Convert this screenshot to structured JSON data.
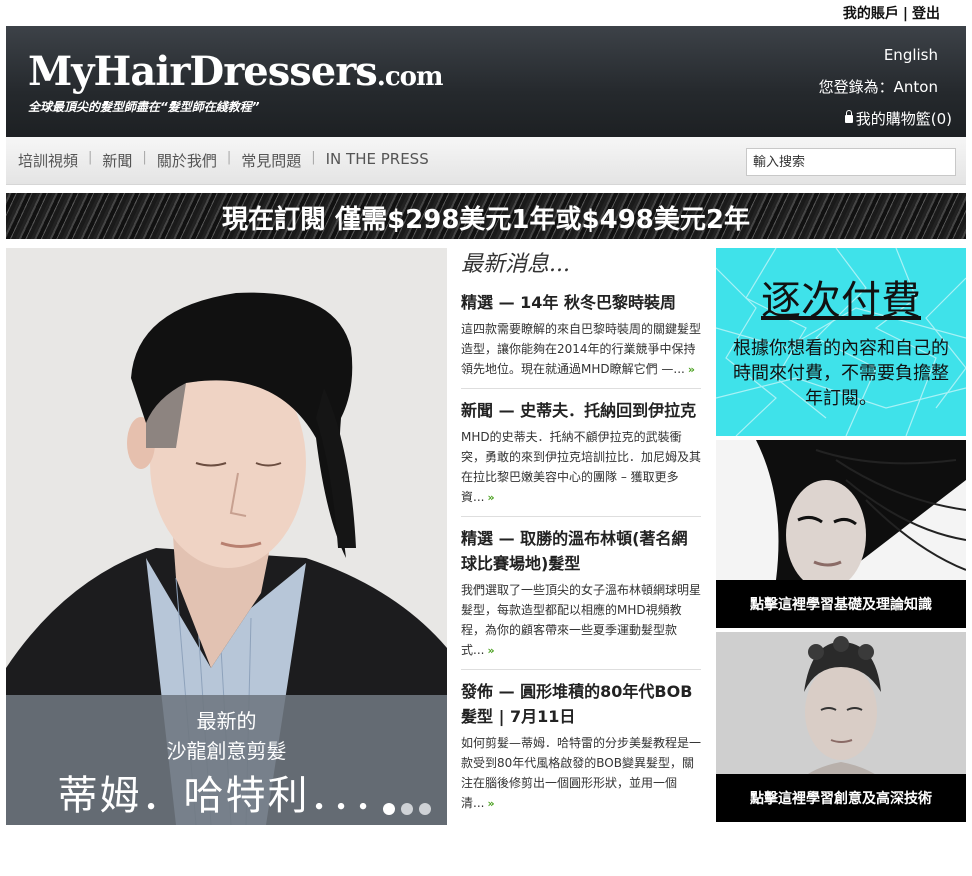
{
  "account": {
    "my_account": "我的賬戶",
    "separator": "|",
    "logout": "登出"
  },
  "header": {
    "logo_main": "MyHairDressers",
    "logo_suffix": ".com",
    "tagline": "全球最頂尖的髮型師盡在“髮型師在綫教程”",
    "language": "English",
    "login_status": "您登錄為：Anton",
    "cart": "我的購物籃(0)"
  },
  "nav": {
    "items": [
      "培訓視頻",
      "新聞",
      "關於我們",
      "常見問題",
      "IN THE PRESS"
    ],
    "search_placeholder": "輸入搜索"
  },
  "banner": {
    "text": "現在訂閱 僅需$298美元1年或$498美元2年"
  },
  "hero": {
    "line1": "最新的",
    "line2": "沙龍創意剪髮",
    "line3": "蒂姆．哈特利．．．",
    "slides_total": 3,
    "active_slide": 1
  },
  "news": {
    "heading": "最新消息...",
    "more_symbol": "»",
    "items": [
      {
        "title": "精選 — 14年 秋冬巴黎時裝周",
        "body": "這四款需要瞭解的來自巴黎時裝周的關鍵髮型造型，讓你能夠在2014年的行業競爭中保持領先地位。現在就通過MHD瞭解它們 —..."
      },
      {
        "title": "新聞 — 史蒂夫．托納回到伊拉克",
        "body": "MHD的史蒂夫．托納不顧伊拉克的武裝衝突，勇敢的來到伊拉克培訓拉比．加尼姆及其在拉比黎巴嫩美容中心的團隊 – 獲取更多資..."
      },
      {
        "title": "精選 — 取勝的溫布林頓(著名網球比賽場地)髮型",
        "body": "我們選取了一些頂尖的女子溫布林頓網球明星髮型，每款造型都配以相應的MHD視頻教程，為你的顧客帶來一些夏季運動髮型款式..."
      },
      {
        "title": "發佈 — 圓形堆積的80年代BOB 髮型 | 7月11日",
        "body": "如何剪髮—蒂姆．哈特雷的分步美髮教程是一款受到80年代風格啟發的BOB變異髮型，關注在腦後修剪出一個圓形形狀，並用一個清..."
      }
    ]
  },
  "promos": {
    "pay_title": "逐次付費",
    "pay_desc": "根據你想看的內容和自己的時間來付費，不需要負擔整年訂閱。",
    "basic": "點擊這裡學習基礎及理論知識",
    "advanced": "點擊這裡學習創意及高深技術"
  },
  "colors": {
    "header_bg": "#25292d",
    "promo_cyan": "#3fe2ea",
    "more_green": "#4aa01f"
  }
}
